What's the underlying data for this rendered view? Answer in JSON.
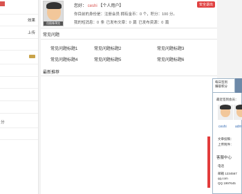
{
  "left_panel": {
    "items": [
      {
        "label": "效果"
      },
      {
        "label": "上传"
      },
      {
        "label": "分"
      }
    ]
  },
  "profile": {
    "greeting": "您好：",
    "username": "ceshi",
    "user_type": "【个人用户】",
    "logout_label": "安全退出",
    "identity_line": "你目前的身份是：注册会员 拥有金币：0 个，积分：100 分。",
    "stats_line": "我的短消息：0 条  已发布文章：0 篇  已发布资源：0 篇",
    "avatar_caption": "用图像预览"
  },
  "faq_section": {
    "title": "常见问题",
    "items": [
      "常见问题标题1",
      "常见问题标题2",
      "常见问题标题3",
      "常见问题标题4",
      "常见问题标题5",
      "常见问题标题6"
    ]
  },
  "recommend_section": {
    "title": "最新推荐"
  },
  "widget": {
    "tab_line1": "每日签到",
    "tab_line2": "赚取积分",
    "recent_visitors": "最近签到会员：",
    "user1": "ceshi",
    "user2": "adm",
    "row_a": "文章投稿：",
    "row_b": "上传附件：",
    "customer_center": "客服中心",
    "phone_label": "电话",
    "email_label": "邮箱 1234567",
    "email2": "qq.com",
    "qq_label": "QQ 1997645"
  },
  "colors": {
    "accent_red": "#e04040",
    "link_blue": "#3a6fb5"
  }
}
